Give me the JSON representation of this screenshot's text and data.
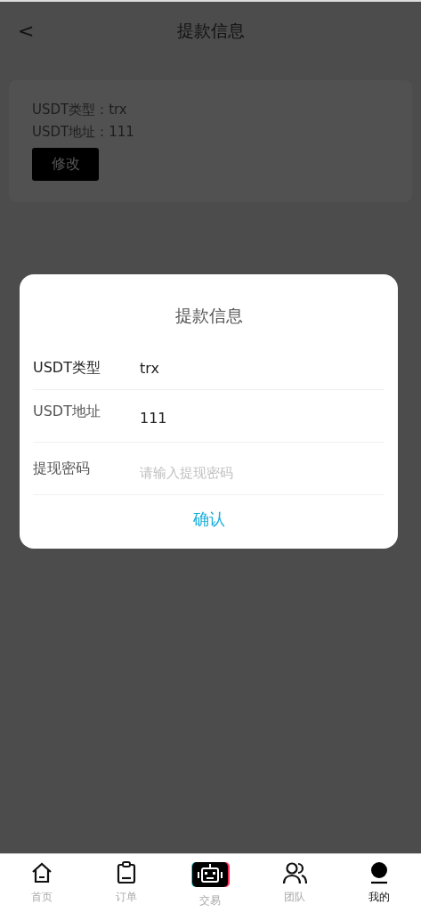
{
  "header": {
    "back": "<",
    "title": "提款信息"
  },
  "info_card": {
    "lines": [
      {
        "label": "USDT类型：",
        "value": "trx"
      },
      {
        "label": "USDT地址：",
        "value": "111"
      }
    ],
    "button": "修改"
  },
  "dialog": {
    "title": "提款信息",
    "fields": [
      {
        "kind": "text",
        "label": "USDT类型",
        "value": "trx"
      },
      {
        "kind": "text",
        "label": "USDT地址",
        "value": "111"
      },
      {
        "kind": "input",
        "label": "提现密码",
        "placeholder": "请输入提现密码"
      }
    ],
    "confirm": "确认"
  },
  "nav": [
    {
      "kind": "home",
      "label": "首页",
      "selected": false
    },
    {
      "kind": "orders",
      "label": "订单",
      "selected": false
    },
    {
      "kind": "trade",
      "label": "交易",
      "selected": false
    },
    {
      "kind": "team",
      "label": "团队",
      "selected": false
    },
    {
      "kind": "me",
      "label": "我的",
      "selected": true
    }
  ]
}
